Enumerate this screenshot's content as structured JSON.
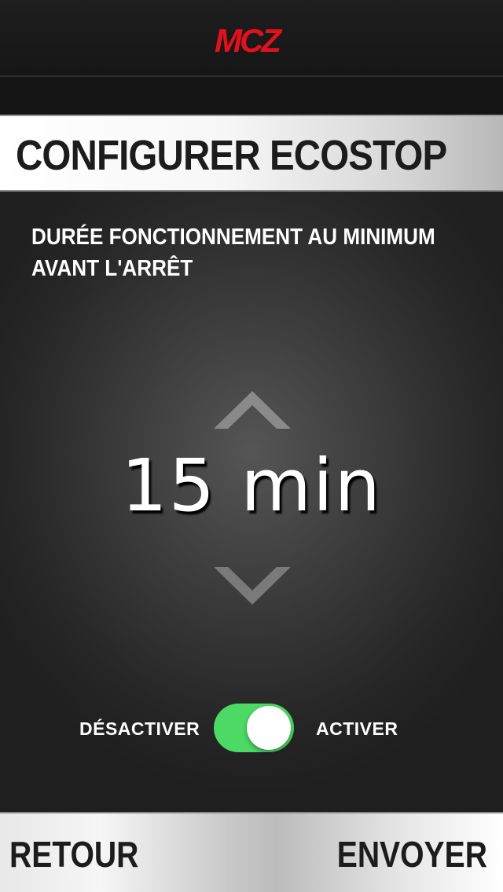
{
  "header": {
    "logo_text": "MCZ",
    "logo_icon": "mcz-logo-icon",
    "brand_color": "#e3101d"
  },
  "title": "CONFIGURER ECOSTOP",
  "setting": {
    "description": "DURÉE FONCTIONNEMENT AU MINIMUM AVANT L'ARRÊT",
    "value": "15 min",
    "increase_icon": "chevron-up-icon",
    "decrease_icon": "chevron-down-icon"
  },
  "toggle": {
    "off_label": "DÉSACTIVER",
    "on_label": "ACTIVER",
    "state": "on",
    "active_color": "#4cd964"
  },
  "footer": {
    "back_label": "RETOUR",
    "send_label": "ENVOYER"
  }
}
